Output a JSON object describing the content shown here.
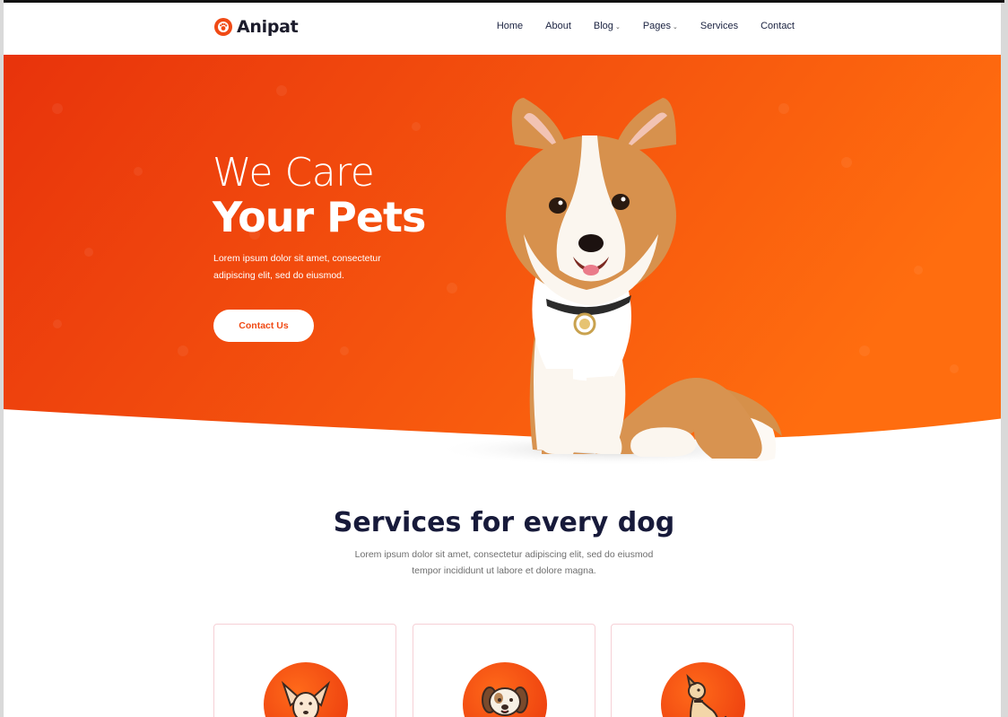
{
  "brand": {
    "name": "Anipat",
    "color": "#f04a15"
  },
  "nav": {
    "items": [
      {
        "label": "Home",
        "dropdown": false
      },
      {
        "label": "About",
        "dropdown": false
      },
      {
        "label": "Blog",
        "dropdown": true
      },
      {
        "label": "Pages",
        "dropdown": true
      },
      {
        "label": "Services",
        "dropdown": false
      },
      {
        "label": "Contact",
        "dropdown": false
      }
    ]
  },
  "hero": {
    "title_light": "We Care",
    "title_bold": "Your Pets",
    "text": "Lorem ipsum dolor sit amet, consectetur adipiscing elit, sed do eiusmod.",
    "button_label": "Contact Us",
    "gradient_start": "#e8330c",
    "gradient_end": "#ff6d0f"
  },
  "services": {
    "title": "Services for every dog",
    "subtitle": "Lorem ipsum dolor sit amet, consectetur adipiscing elit, sed do eiusmod tempor incididunt ut labore et dolore magna.",
    "cards": [
      {
        "icon": "chihuahua-icon"
      },
      {
        "icon": "puppy-icon"
      },
      {
        "icon": "sitting-dog-icon"
      }
    ]
  }
}
